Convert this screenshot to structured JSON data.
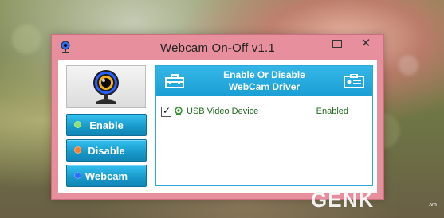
{
  "window": {
    "title": "Webcam On-Off v1.1"
  },
  "left_panel": {
    "buttons": {
      "enable": "Enable",
      "disable": "Disable",
      "webcam": "Webcam"
    }
  },
  "driver_panel": {
    "header_line1": "Enable Or Disable",
    "header_line2": "WebCam Driver",
    "devices": [
      {
        "name": "USB Video Device",
        "status": "Enabled",
        "checked": true
      }
    ]
  },
  "overlay": {
    "watermark": "GENK",
    "watermark_sub": ".vn"
  },
  "colors": {
    "window_frame": "#e88f9e",
    "accent_blue": "#1a9fd4",
    "enabled_text": "#1f6b1f",
    "dot_enable": "#8fe06a",
    "dot_disable": "#ff7a2a",
    "dot_webcam": "#2b6fff"
  },
  "icons": {
    "app": "webcam-app-icon",
    "camera_tile": "webcam-icon",
    "header_left": "toolbox-icon",
    "header_right": "id-card-icon",
    "device": "webcam-small-icon"
  }
}
